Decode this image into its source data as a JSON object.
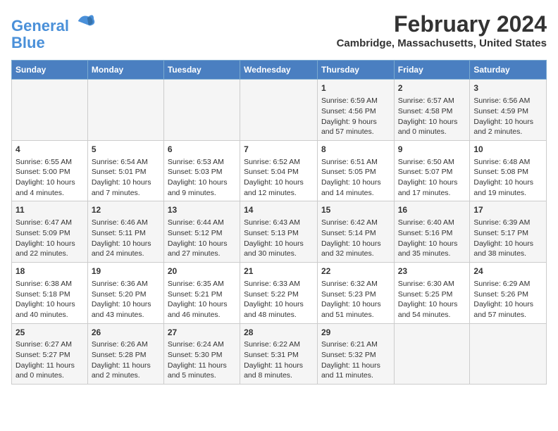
{
  "logo": {
    "line1": "General",
    "line2": "Blue"
  },
  "title": "February 2024",
  "subtitle": "Cambridge, Massachusetts, United States",
  "weekdays": [
    "Sunday",
    "Monday",
    "Tuesday",
    "Wednesday",
    "Thursday",
    "Friday",
    "Saturday"
  ],
  "weeks": [
    [
      {
        "day": "",
        "info": ""
      },
      {
        "day": "",
        "info": ""
      },
      {
        "day": "",
        "info": ""
      },
      {
        "day": "",
        "info": ""
      },
      {
        "day": "1",
        "info": "Sunrise: 6:59 AM\nSunset: 4:56 PM\nDaylight: 9 hours and 57 minutes."
      },
      {
        "day": "2",
        "info": "Sunrise: 6:57 AM\nSunset: 4:58 PM\nDaylight: 10 hours and 0 minutes."
      },
      {
        "day": "3",
        "info": "Sunrise: 6:56 AM\nSunset: 4:59 PM\nDaylight: 10 hours and 2 minutes."
      }
    ],
    [
      {
        "day": "4",
        "info": "Sunrise: 6:55 AM\nSunset: 5:00 PM\nDaylight: 10 hours and 4 minutes."
      },
      {
        "day": "5",
        "info": "Sunrise: 6:54 AM\nSunset: 5:01 PM\nDaylight: 10 hours and 7 minutes."
      },
      {
        "day": "6",
        "info": "Sunrise: 6:53 AM\nSunset: 5:03 PM\nDaylight: 10 hours and 9 minutes."
      },
      {
        "day": "7",
        "info": "Sunrise: 6:52 AM\nSunset: 5:04 PM\nDaylight: 10 hours and 12 minutes."
      },
      {
        "day": "8",
        "info": "Sunrise: 6:51 AM\nSunset: 5:05 PM\nDaylight: 10 hours and 14 minutes."
      },
      {
        "day": "9",
        "info": "Sunrise: 6:50 AM\nSunset: 5:07 PM\nDaylight: 10 hours and 17 minutes."
      },
      {
        "day": "10",
        "info": "Sunrise: 6:48 AM\nSunset: 5:08 PM\nDaylight: 10 hours and 19 minutes."
      }
    ],
    [
      {
        "day": "11",
        "info": "Sunrise: 6:47 AM\nSunset: 5:09 PM\nDaylight: 10 hours and 22 minutes."
      },
      {
        "day": "12",
        "info": "Sunrise: 6:46 AM\nSunset: 5:11 PM\nDaylight: 10 hours and 24 minutes."
      },
      {
        "day": "13",
        "info": "Sunrise: 6:44 AM\nSunset: 5:12 PM\nDaylight: 10 hours and 27 minutes."
      },
      {
        "day": "14",
        "info": "Sunrise: 6:43 AM\nSunset: 5:13 PM\nDaylight: 10 hours and 30 minutes."
      },
      {
        "day": "15",
        "info": "Sunrise: 6:42 AM\nSunset: 5:14 PM\nDaylight: 10 hours and 32 minutes."
      },
      {
        "day": "16",
        "info": "Sunrise: 6:40 AM\nSunset: 5:16 PM\nDaylight: 10 hours and 35 minutes."
      },
      {
        "day": "17",
        "info": "Sunrise: 6:39 AM\nSunset: 5:17 PM\nDaylight: 10 hours and 38 minutes."
      }
    ],
    [
      {
        "day": "18",
        "info": "Sunrise: 6:38 AM\nSunset: 5:18 PM\nDaylight: 10 hours and 40 minutes."
      },
      {
        "day": "19",
        "info": "Sunrise: 6:36 AM\nSunset: 5:20 PM\nDaylight: 10 hours and 43 minutes."
      },
      {
        "day": "20",
        "info": "Sunrise: 6:35 AM\nSunset: 5:21 PM\nDaylight: 10 hours and 46 minutes."
      },
      {
        "day": "21",
        "info": "Sunrise: 6:33 AM\nSunset: 5:22 PM\nDaylight: 10 hours and 48 minutes."
      },
      {
        "day": "22",
        "info": "Sunrise: 6:32 AM\nSunset: 5:23 PM\nDaylight: 10 hours and 51 minutes."
      },
      {
        "day": "23",
        "info": "Sunrise: 6:30 AM\nSunset: 5:25 PM\nDaylight: 10 hours and 54 minutes."
      },
      {
        "day": "24",
        "info": "Sunrise: 6:29 AM\nSunset: 5:26 PM\nDaylight: 10 hours and 57 minutes."
      }
    ],
    [
      {
        "day": "25",
        "info": "Sunrise: 6:27 AM\nSunset: 5:27 PM\nDaylight: 11 hours and 0 minutes."
      },
      {
        "day": "26",
        "info": "Sunrise: 6:26 AM\nSunset: 5:28 PM\nDaylight: 11 hours and 2 minutes."
      },
      {
        "day": "27",
        "info": "Sunrise: 6:24 AM\nSunset: 5:30 PM\nDaylight: 11 hours and 5 minutes."
      },
      {
        "day": "28",
        "info": "Sunrise: 6:22 AM\nSunset: 5:31 PM\nDaylight: 11 hours and 8 minutes."
      },
      {
        "day": "29",
        "info": "Sunrise: 6:21 AM\nSunset: 5:32 PM\nDaylight: 11 hours and 11 minutes."
      },
      {
        "day": "",
        "info": ""
      },
      {
        "day": "",
        "info": ""
      }
    ]
  ]
}
